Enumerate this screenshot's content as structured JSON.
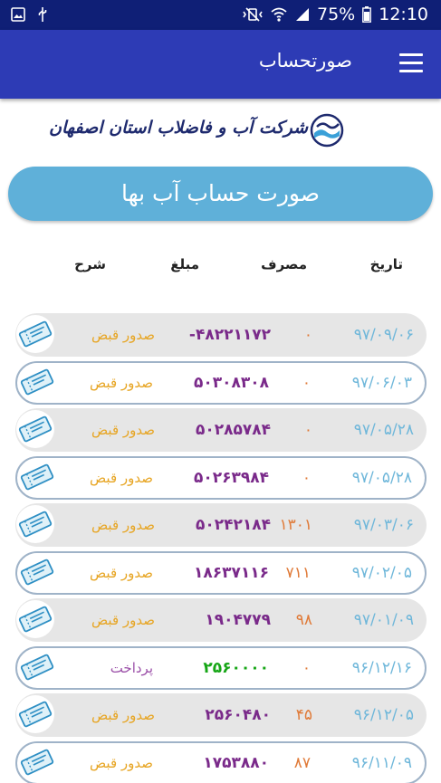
{
  "status_bar": {
    "battery": "75%",
    "time": "12:10"
  },
  "app_bar": {
    "title": "صورتحساب"
  },
  "brand": {
    "name": "شرکت آب و فاضلاب استان اصفهان"
  },
  "banner": {
    "title": "صورت حساب آب بها"
  },
  "table": {
    "headers": {
      "date": "تاریخ",
      "usage": "مصرف",
      "amount": "مبلغ",
      "description": "شرح"
    },
    "rows": [
      {
        "date": "۹۷/۰۹/۰۶",
        "usage": "۰",
        "amount": "۴۸۲۲۱۱۷۲-",
        "desc": "صدور قبض",
        "style": "filled",
        "type": "bill"
      },
      {
        "date": "۹۷/۰۶/۰۳",
        "usage": "۰",
        "amount": "۵۰۳۰۸۳۰۸",
        "desc": "صدور قبض",
        "style": "outlined",
        "type": "bill"
      },
      {
        "date": "۹۷/۰۵/۲۸",
        "usage": "۰",
        "amount": "۵۰۲۸۵۷۸۴",
        "desc": "صدور قبض",
        "style": "filled",
        "type": "bill"
      },
      {
        "date": "۹۷/۰۵/۲۸",
        "usage": "۰",
        "amount": "۵۰۲۶۳۹۸۴",
        "desc": "صدور قبض",
        "style": "outlined",
        "type": "bill"
      },
      {
        "date": "۹۷/۰۳/۰۶",
        "usage": "۱۳۰۱",
        "amount": "۵۰۲۴۲۱۸۴",
        "desc": "صدور قبض",
        "style": "filled",
        "type": "bill"
      },
      {
        "date": "۹۷/۰۲/۰۵",
        "usage": "۷۱۱",
        "amount": "۱۸۶۳۷۱۱۶",
        "desc": "صدور قبض",
        "style": "outlined",
        "type": "bill"
      },
      {
        "date": "۹۷/۰۱/۰۹",
        "usage": "۹۸",
        "amount": "۱۹۰۴۷۷۹",
        "desc": "صدور قبض",
        "style": "filled",
        "type": "bill"
      },
      {
        "date": "۹۶/۱۲/۱۶",
        "usage": "۰",
        "amount": "۲۵۶۰۰۰۰",
        "desc": "پرداخت",
        "style": "outlined",
        "type": "payment"
      },
      {
        "date": "۹۶/۱۲/۰۵",
        "usage": "۴۵",
        "amount": "۲۵۶۰۴۸۰",
        "desc": "صدور قبض",
        "style": "filled",
        "type": "bill"
      },
      {
        "date": "۹۶/۱۱/۰۹",
        "usage": "۸۷",
        "amount": "۱۷۵۳۸۸۰",
        "desc": "صدور قبض",
        "style": "outlined",
        "type": "bill"
      }
    ]
  },
  "colors": {
    "status_bar": "#0f1f76",
    "app_bar": "#2d3bb5",
    "banner": "#5fb0d9",
    "date": "#6fb7da",
    "usage": "#e07b39",
    "amount": "#7a2a8a",
    "bill_desc": "#e7a523",
    "payment_desc": "#9b4fa8",
    "payment_amount": "#16a616"
  },
  "icons": {
    "status_left": [
      "gallery-icon",
      "usb-icon"
    ],
    "status_right": [
      "vibrate-mute-icon",
      "wifi-icon",
      "signal-icon"
    ],
    "menu": "hamburger-menu-icon",
    "logo": "water-company-logo-icon",
    "row": "ticket-icon"
  }
}
